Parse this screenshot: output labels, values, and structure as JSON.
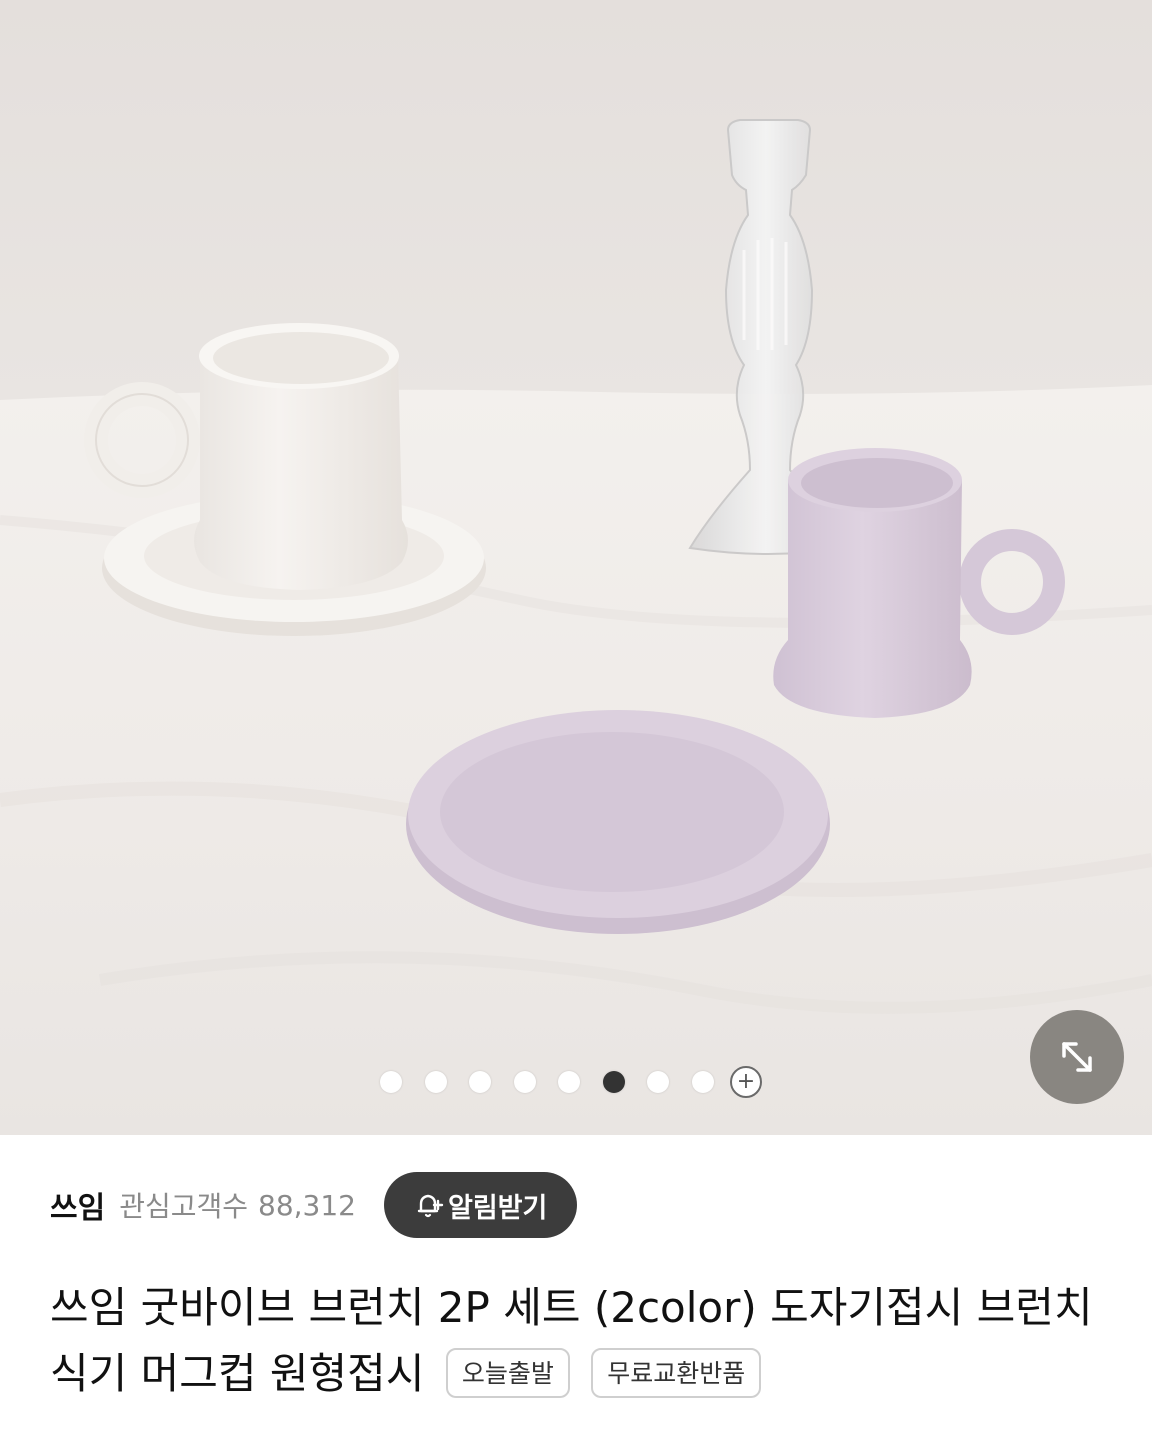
{
  "gallery": {
    "dot_count": 8,
    "active_index": 5,
    "more_symbol": "+",
    "expand_icon": "expand-arrows-icon"
  },
  "store": {
    "name": "쓰임",
    "fans_label": "관심고객수",
    "fans_count": "88,312",
    "alarm_button": "알림받기",
    "alarm_icon": "bell-plus-icon"
  },
  "product": {
    "title": "쓰임 굿바이브 브런치 2P 세트 (2color) 도자기접시 브런치식기 머그컵 원형접시",
    "tags": [
      "오늘출발",
      "무료교환반품"
    ]
  },
  "colors": {
    "dark_button": "#3c3c3c",
    "active_dot": "#333333"
  }
}
